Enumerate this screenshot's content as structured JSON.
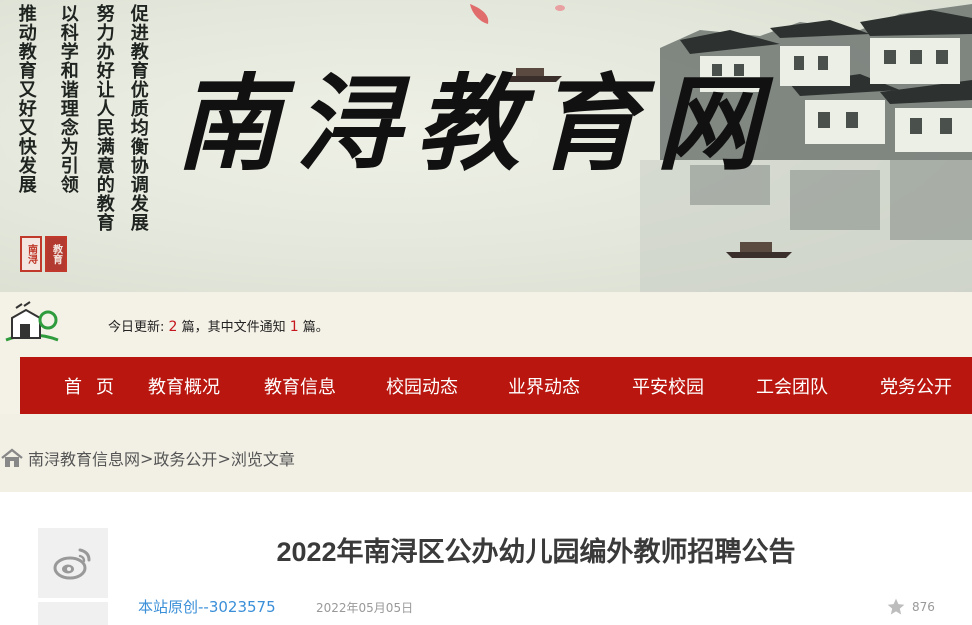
{
  "banner": {
    "title": "南浔教育网",
    "slogan_lines": [
      "促进教育优质均衡协调发展",
      "努力办好让人民满意的教育",
      "以科学和谐理念为引领",
      "推动教育又好又快发展"
    ],
    "seal_left": "南浔",
    "seal_right": "教育"
  },
  "update": {
    "prefix": "今日更新: ",
    "count_today": "2",
    "mid": " 篇，其中文件通知 ",
    "count_notice": "1",
    "suffix": " 篇。"
  },
  "nav": {
    "items": [
      "首页",
      "教育概况",
      "教育信息",
      "校园动态",
      "业界动态",
      "平安校园",
      "工会团队",
      "党务公开"
    ]
  },
  "breadcrumb": {
    "items": [
      "南浔教育信息网",
      "政务公开",
      "浏览文章"
    ],
    "separator": "> "
  },
  "article": {
    "title": "2022年南浔区公办幼儿园编外教师招聘公告",
    "source": "本站原创--3023575",
    "date": "2022年05月05日",
    "views": "876"
  },
  "icons": {
    "weibo": "weibo-icon",
    "star": "star-icon",
    "home": "home-icon"
  },
  "colors": {
    "nav_bg": "#b8160e",
    "accent_red": "#c4161c",
    "link_blue": "#3a8fd8"
  }
}
